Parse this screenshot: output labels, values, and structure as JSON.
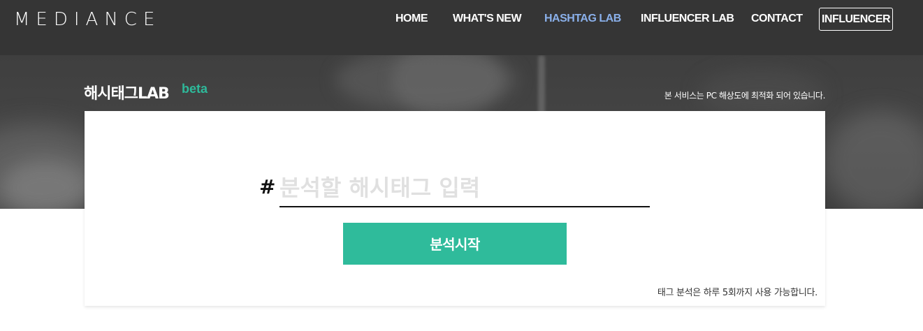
{
  "brand": {
    "logo_text": "MEDIANCE"
  },
  "nav": {
    "items": [
      {
        "label": "HOME",
        "active": false
      },
      {
        "label": "WHAT'S NEW",
        "active": false
      },
      {
        "label": "HASHTAG LAB",
        "active": true
      },
      {
        "label": "INFLUENCER LAB",
        "active": false
      },
      {
        "label": "CONTACT",
        "active": false
      }
    ],
    "button_label": "INFLUENCER",
    "active_color": "#8ab0ea"
  },
  "hero": {
    "title": "해시태그LAB",
    "badge": "beta",
    "notice": "본 서비스는 PC 해상도에 최적화 되어 있습니다."
  },
  "search": {
    "symbol": "#",
    "value": "",
    "placeholder": "분석할 해시태그 입력",
    "button_label": "분석시작",
    "limit_note": "태그 분석은 하루 5회까지 사용 가능합니다."
  },
  "colors": {
    "navbar_bg": "#353535",
    "accent_green": "#2fbb9b",
    "hero_bg": "#424242"
  }
}
